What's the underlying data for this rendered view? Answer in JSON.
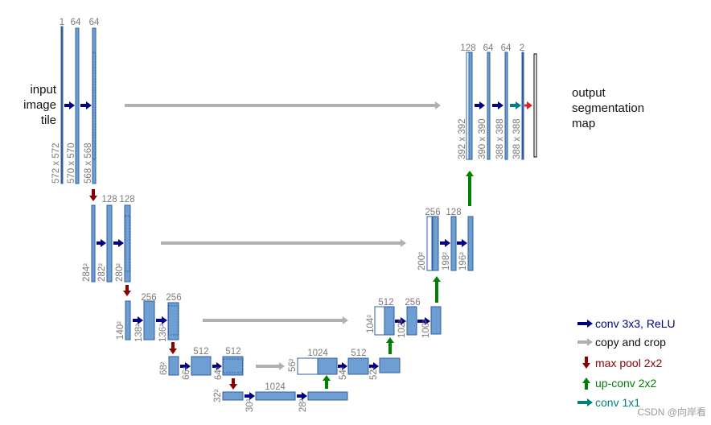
{
  "input_label": [
    "input",
    "image",
    "tile"
  ],
  "output_label": [
    "output",
    "segmentation",
    "map"
  ],
  "channel_labels": [
    "1",
    "64",
    "64",
    "128",
    "128",
    "256",
    "256",
    "512",
    "512",
    "1024",
    "1024",
    "512",
    "512",
    "256",
    "256",
    "128",
    "128",
    "64",
    "64",
    "2"
  ],
  "size_labels": [
    "572 x 572",
    "570 x 570",
    "568 x 568",
    "284²",
    "282²",
    "280²",
    "140²",
    "138²",
    "136²",
    "68²",
    "66²",
    "64²",
    "32²",
    "30²",
    "28²",
    "56²",
    "54²",
    "52²",
    "104²",
    "102²",
    "100²",
    "200²",
    "198²",
    "196²",
    "392 x 392",
    "390 x 390",
    "388 x 388",
    "388 x 388"
  ],
  "legend": [
    {
      "label": "conv 3x3, ReLU",
      "icon": "arrow-right",
      "color": "#000080"
    },
    {
      "label": "copy and crop",
      "icon": "arrow-right",
      "color": "#b0b0b0"
    },
    {
      "label": "max pool 2x2",
      "icon": "arrow-down",
      "color": "#8b0000"
    },
    {
      "label": "up-conv 2x2",
      "icon": "arrow-up",
      "color": "#008000"
    },
    {
      "label": "conv 1x1",
      "icon": "arrow-right",
      "color": "#008080"
    }
  ],
  "colors": {
    "feature_map": "#6f9fd2",
    "feature_map_border": "#2f5f9f",
    "conv": "#000080",
    "copy": "#b0b0b0",
    "pool": "#8b0000",
    "upconv": "#008000",
    "conv1x1": "#008080",
    "final": "#e02020"
  },
  "watermark": "CSDN @向岸看"
}
